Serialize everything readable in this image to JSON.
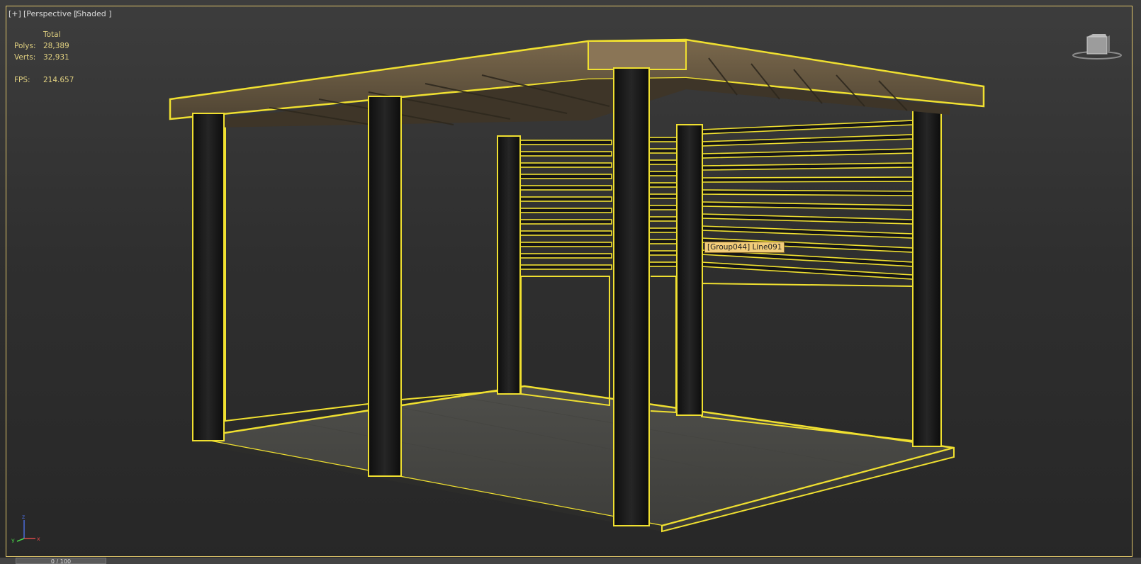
{
  "viewport": {
    "label_plus": "[+]",
    "label_view": "[Perspective ]",
    "label_shading": "[Shaded ]"
  },
  "stats": {
    "header": "Total",
    "polys_label": "Polys:",
    "polys_value": "28,389",
    "verts_label": "Verts:",
    "verts_value": "32,931",
    "fps_label": "FPS:",
    "fps_value": "214.657"
  },
  "tooltip": "[Group044] Line091",
  "axis": {
    "x": "x",
    "y": "y",
    "z": "z"
  },
  "timeline": {
    "frame_readout": "0 / 100"
  },
  "colors": {
    "selection_outline": "#f0e030",
    "beam_wood": "#6f5f45",
    "post": "#161616",
    "floor": "#4a4a46",
    "tooltip_bg": "#f2cd7a",
    "frame_border": "#e0c56a"
  },
  "icons": {
    "viewcube": "viewcube-icon",
    "axis": "axis-tripod-icon"
  }
}
